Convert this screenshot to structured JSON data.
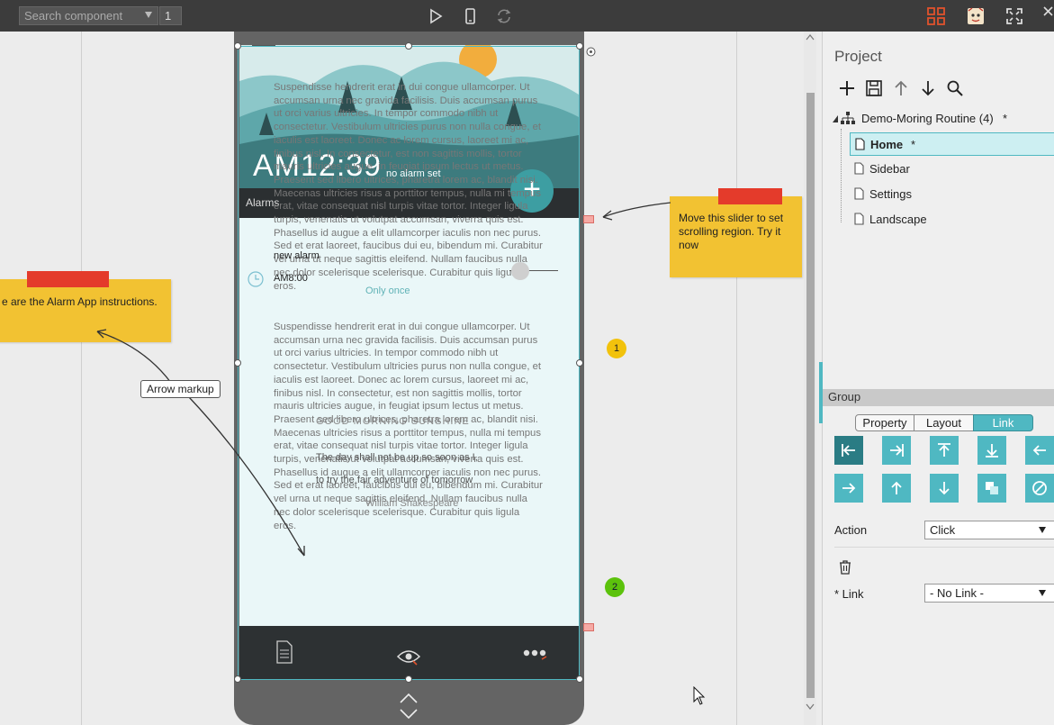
{
  "toolbar": {
    "search_placeholder": "Search component",
    "page_number": "1"
  },
  "device": {
    "alarm_time": "AM12:39",
    "no_alarm": "no alarm set",
    "alarms_label": "Alarms",
    "lorem_1": "Suspendisse hendrerit erat in dui congue ullamcorper. Ut accumsan urna nec gravida facilisis. Duis accumsan purus ut orci varius ultricies. In tempor commodo nibh ut consectetur. Vestibulum ultricies purus non nulla congue, et iaculis est laoreet. Donec ac lorem cursus, laoreet mi ac, finibus nisl. In consectetur, est non sagittis mollis, tortor mauris ultricies augue, in feugiat ipsum lectus ut metus. Praesent sed libero ultrices, pharetra lorem ac, blandit nisi. Maecenas ultricies risus a porttitor tempus, nulla mi tempus erat, vitae consequat nisl turpis vitae tortor. Integer ligula turpis, venenatis ut volutpat accumsan, viverra quis est. Phasellus id augue a elit ullamcorper iaculis non nec purus. Sed et erat laoreet, faucibus dui eu, bibendum mi. Curabitur vel urna ut neque sagittis eleifend. Nullam faucibus nulla nec dolor scelerisque scelerisque. Curabitur quis ligula eros.",
    "lorem_2": "Suspendisse hendrerit erat in dui congue ullamcorper. Ut accumsan urna nec gravida facilisis. Duis accumsan purus ut orci varius ultricies. In tempor commodo nibh ut consectetur. Vestibulum ultricies purus non nulla congue, et iaculis est laoreet. Donec ac lorem cursus, laoreet mi ac, finibus nisl. In consectetur, est non sagittis mollis, tortor mauris ultricies augue, in feugiat ipsum lectus ut metus. Praesent sed libero ultrices, pharetra lorem ac, blandit nisi. Maecenas ultricies risus a porttitor tempus, nulla mi tempus erat, vitae consequat nisl turpis vitae tortor. Integer ligula turpis, venenatis ut volutpat accumsan, viverra quis est. Phasellus id augue a elit ullamcorper iaculis non nec purus. Sed et erat laoreet, faucibus dui eu, bibendum mi. Curabitur vel urna ut neque sagittis eleifend. Nullam faucibus nulla nec dolor scelerisque scelerisque. Curabitur quis ligula eros.",
    "new_alarm": "new alarm",
    "alarm_800": "AM8:00",
    "only_once": "Only once",
    "quote_title": "GOOD MORNING SUNSHINE",
    "quote_line_1": "The day shall not be up so soon as I,",
    "quote_line_2": "to try the fair adventure of tomorrow",
    "quote_author": "William Shakespeare"
  },
  "annotations": {
    "sticky_left": "e are the Alarm App instructions.",
    "sticky_right": "Move this slider to set scrolling region. Try it now",
    "arrow_markup": "Arrow markup",
    "badge_1": "1",
    "badge_2": "2"
  },
  "panel": {
    "project_title": "Project",
    "tree": {
      "root": "Demo-Moring Routine (4)",
      "root_mark": "*",
      "home": "Home",
      "home_mark": "*",
      "sidebar": "Sidebar",
      "settings": "Settings",
      "landscape": "Landscape"
    },
    "group_label": "Group",
    "tabs": {
      "property": "Property",
      "layout": "Layout",
      "link": "Link"
    },
    "action_label": "Action",
    "action_value": "Click",
    "link_label": "* Link",
    "link_value": "- No Link -"
  },
  "colors": {
    "accent": "#4fb8c2",
    "sticky": "#f2c232",
    "sticky_tab": "#e43b2b",
    "toolbar": "#3c3c3c"
  }
}
